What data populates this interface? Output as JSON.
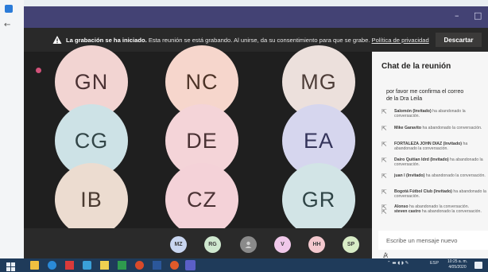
{
  "window": {
    "minimize": "–",
    "maximize": "□"
  },
  "recording_bar": {
    "strong": "La grabación se ha iniciado.",
    "text": " Esta reunión se está grabando. Al unirse, da su consentimiento para que se grabe. ",
    "link": "Política de privacidad",
    "button": "Descartar"
  },
  "gallery": {
    "tiles": [
      "GN",
      "NC",
      "MG",
      "CG",
      "DE",
      "EA",
      "IB",
      "CZ",
      "GR"
    ]
  },
  "avatars": [
    "MZ",
    "RG",
    "V",
    "HH",
    "SP"
  ],
  "chat": {
    "title": "Chat de la reunión",
    "partial_message": [
      "por favor me confirma el correo",
      "de la Dra Leila"
    ],
    "events": [
      {
        "name": "Salomón (Invitado)",
        "text": " ha abandonado la conversación."
      },
      {
        "name": "Mike Garavito",
        "text": " ha abandonado la conversación."
      },
      {
        "name": "FORTALEZA JOHN DIAZ (Invitado)",
        "text": " ha abandonado la conversación."
      },
      {
        "name": "Dairo Quitian Idrd (Invitado)",
        "text": " ha abandonado la conversación."
      },
      {
        "name": "juan l (Invitado)",
        "text": " ha abandonado la conversación."
      },
      {
        "name": "Bogotá Fútbol Club (Invitado)",
        "text": " ha abandonado la conversación."
      },
      {
        "name": "Alonso",
        "text": " ha abandonado la conversación."
      },
      {
        "name": "steven castro",
        "text": " ha abandonado la conversación."
      }
    ],
    "input_placeholder": "Escribe un mensaje nuevo"
  },
  "taskbar": {
    "language": "ESP",
    "time": "10:25 a. m.",
    "date": "4/05/2020"
  },
  "colors": {
    "titlebar": "#434274",
    "recording_dot": "#d2527a",
    "taskbar": "#1f3b5a"
  }
}
